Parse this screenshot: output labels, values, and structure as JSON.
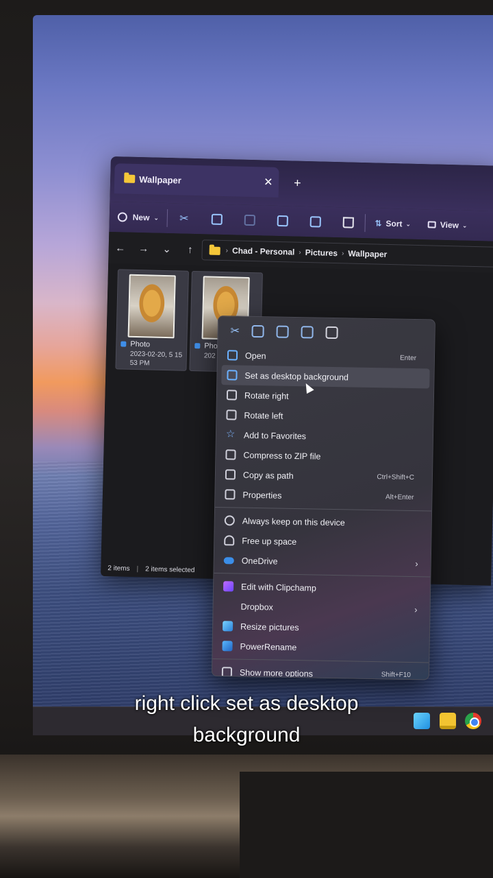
{
  "window": {
    "tab_title": "Wallpaper",
    "tab_close": "✕",
    "tab_add": "+"
  },
  "toolbar": {
    "new_label": "New",
    "sort_label": "Sort",
    "view_label": "View"
  },
  "nav": {
    "back": "←",
    "forward": "→",
    "recent": "⌄",
    "up": "↑"
  },
  "breadcrumb": [
    "Chad - Personal",
    "Pictures",
    "Wallpaper"
  ],
  "files": [
    {
      "name": "Photo",
      "meta": "2023-02-20, 5 15 53 PM"
    },
    {
      "name": "Pho",
      "meta": "202 28 1"
    }
  ],
  "status": {
    "items": "2 items",
    "selected": "2 items selected"
  },
  "context_menu": {
    "items": [
      {
        "label": "Open",
        "shortcut": "Enter"
      },
      {
        "label": "Set as desktop background",
        "shortcut": ""
      },
      {
        "label": "Rotate right",
        "shortcut": ""
      },
      {
        "label": "Rotate left",
        "shortcut": ""
      },
      {
        "label": "Add to Favorites",
        "shortcut": ""
      },
      {
        "label": "Compress to ZIP file",
        "shortcut": ""
      },
      {
        "label": "Copy as path",
        "shortcut": "Ctrl+Shift+C"
      },
      {
        "label": "Properties",
        "shortcut": "Alt+Enter"
      },
      {
        "label": "Always keep on this device",
        "shortcut": ""
      },
      {
        "label": "Free up space",
        "shortcut": ""
      },
      {
        "label": "OneDrive",
        "shortcut": ""
      },
      {
        "label": "Edit with Clipchamp",
        "shortcut": ""
      },
      {
        "label": "Dropbox",
        "shortcut": ""
      },
      {
        "label": "Resize pictures",
        "shortcut": ""
      },
      {
        "label": "PowerRename",
        "shortcut": ""
      },
      {
        "label": "Show more options",
        "shortcut": "Shift+F10"
      }
    ],
    "submenu_arrow": "›"
  },
  "caption": {
    "line1": "right click set as desktop",
    "line2": "background"
  }
}
